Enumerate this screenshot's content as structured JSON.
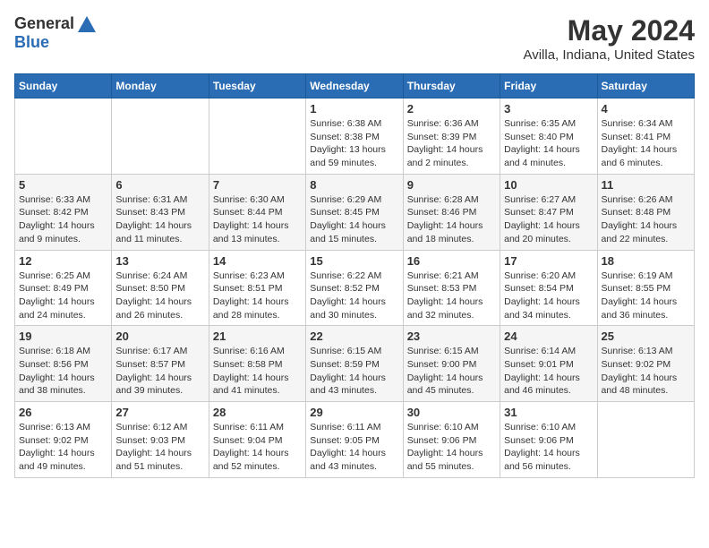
{
  "header": {
    "logo_general": "General",
    "logo_blue": "Blue",
    "month_year": "May 2024",
    "location": "Avilla, Indiana, United States"
  },
  "days_of_week": [
    "Sunday",
    "Monday",
    "Tuesday",
    "Wednesday",
    "Thursday",
    "Friday",
    "Saturday"
  ],
  "weeks": [
    [
      {
        "day": "",
        "info": ""
      },
      {
        "day": "",
        "info": ""
      },
      {
        "day": "",
        "info": ""
      },
      {
        "day": "1",
        "info": "Sunrise: 6:38 AM\nSunset: 8:38 PM\nDaylight: 13 hours and 59 minutes."
      },
      {
        "day": "2",
        "info": "Sunrise: 6:36 AM\nSunset: 8:39 PM\nDaylight: 14 hours and 2 minutes."
      },
      {
        "day": "3",
        "info": "Sunrise: 6:35 AM\nSunset: 8:40 PM\nDaylight: 14 hours and 4 minutes."
      },
      {
        "day": "4",
        "info": "Sunrise: 6:34 AM\nSunset: 8:41 PM\nDaylight: 14 hours and 6 minutes."
      }
    ],
    [
      {
        "day": "5",
        "info": "Sunrise: 6:33 AM\nSunset: 8:42 PM\nDaylight: 14 hours and 9 minutes."
      },
      {
        "day": "6",
        "info": "Sunrise: 6:31 AM\nSunset: 8:43 PM\nDaylight: 14 hours and 11 minutes."
      },
      {
        "day": "7",
        "info": "Sunrise: 6:30 AM\nSunset: 8:44 PM\nDaylight: 14 hours and 13 minutes."
      },
      {
        "day": "8",
        "info": "Sunrise: 6:29 AM\nSunset: 8:45 PM\nDaylight: 14 hours and 15 minutes."
      },
      {
        "day": "9",
        "info": "Sunrise: 6:28 AM\nSunset: 8:46 PM\nDaylight: 14 hours and 18 minutes."
      },
      {
        "day": "10",
        "info": "Sunrise: 6:27 AM\nSunset: 8:47 PM\nDaylight: 14 hours and 20 minutes."
      },
      {
        "day": "11",
        "info": "Sunrise: 6:26 AM\nSunset: 8:48 PM\nDaylight: 14 hours and 22 minutes."
      }
    ],
    [
      {
        "day": "12",
        "info": "Sunrise: 6:25 AM\nSunset: 8:49 PM\nDaylight: 14 hours and 24 minutes."
      },
      {
        "day": "13",
        "info": "Sunrise: 6:24 AM\nSunset: 8:50 PM\nDaylight: 14 hours and 26 minutes."
      },
      {
        "day": "14",
        "info": "Sunrise: 6:23 AM\nSunset: 8:51 PM\nDaylight: 14 hours and 28 minutes."
      },
      {
        "day": "15",
        "info": "Sunrise: 6:22 AM\nSunset: 8:52 PM\nDaylight: 14 hours and 30 minutes."
      },
      {
        "day": "16",
        "info": "Sunrise: 6:21 AM\nSunset: 8:53 PM\nDaylight: 14 hours and 32 minutes."
      },
      {
        "day": "17",
        "info": "Sunrise: 6:20 AM\nSunset: 8:54 PM\nDaylight: 14 hours and 34 minutes."
      },
      {
        "day": "18",
        "info": "Sunrise: 6:19 AM\nSunset: 8:55 PM\nDaylight: 14 hours and 36 minutes."
      }
    ],
    [
      {
        "day": "19",
        "info": "Sunrise: 6:18 AM\nSunset: 8:56 PM\nDaylight: 14 hours and 38 minutes."
      },
      {
        "day": "20",
        "info": "Sunrise: 6:17 AM\nSunset: 8:57 PM\nDaylight: 14 hours and 39 minutes."
      },
      {
        "day": "21",
        "info": "Sunrise: 6:16 AM\nSunset: 8:58 PM\nDaylight: 14 hours and 41 minutes."
      },
      {
        "day": "22",
        "info": "Sunrise: 6:15 AM\nSunset: 8:59 PM\nDaylight: 14 hours and 43 minutes."
      },
      {
        "day": "23",
        "info": "Sunrise: 6:15 AM\nSunset: 9:00 PM\nDaylight: 14 hours and 45 minutes."
      },
      {
        "day": "24",
        "info": "Sunrise: 6:14 AM\nSunset: 9:01 PM\nDaylight: 14 hours and 46 minutes."
      },
      {
        "day": "25",
        "info": "Sunrise: 6:13 AM\nSunset: 9:02 PM\nDaylight: 14 hours and 48 minutes."
      }
    ],
    [
      {
        "day": "26",
        "info": "Sunrise: 6:13 AM\nSunset: 9:02 PM\nDaylight: 14 hours and 49 minutes."
      },
      {
        "day": "27",
        "info": "Sunrise: 6:12 AM\nSunset: 9:03 PM\nDaylight: 14 hours and 51 minutes."
      },
      {
        "day": "28",
        "info": "Sunrise: 6:11 AM\nSunset: 9:04 PM\nDaylight: 14 hours and 52 minutes."
      },
      {
        "day": "29",
        "info": "Sunrise: 6:11 AM\nSunset: 9:05 PM\nDaylight: 14 hours and 43 minutes."
      },
      {
        "day": "30",
        "info": "Sunrise: 6:10 AM\nSunset: 9:06 PM\nDaylight: 14 hours and 55 minutes."
      },
      {
        "day": "31",
        "info": "Sunrise: 6:10 AM\nSunset: 9:06 PM\nDaylight: 14 hours and 56 minutes."
      },
      {
        "day": "",
        "info": ""
      }
    ]
  ]
}
